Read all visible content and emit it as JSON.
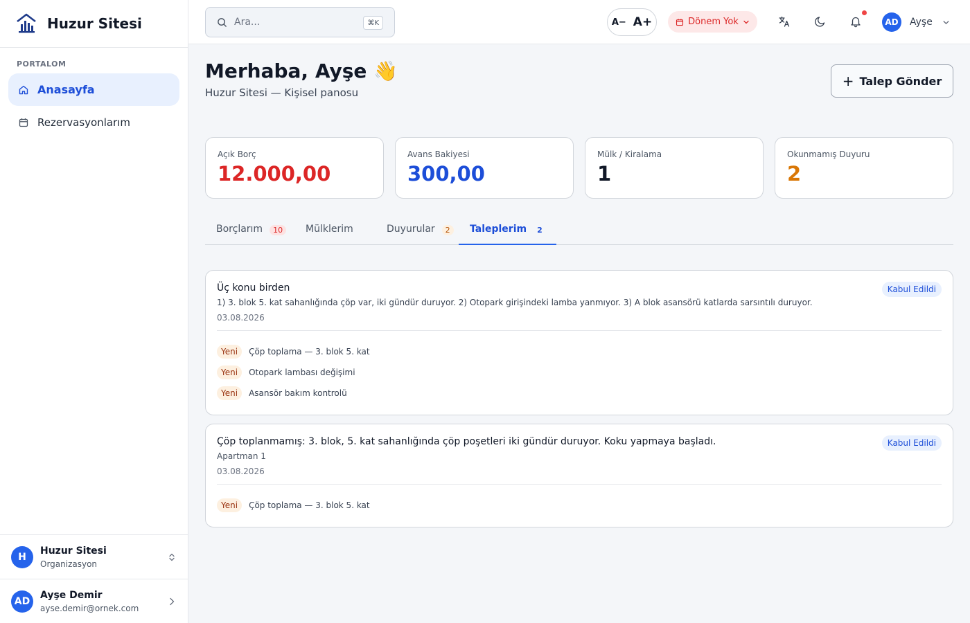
{
  "brand": {
    "name": "Huzur Sitesi"
  },
  "sidebar": {
    "section_label": "PORTALOM",
    "items": [
      {
        "label": "Anasayfa",
        "icon": "home-icon",
        "active": true
      },
      {
        "label": "Rezervasyonlarım",
        "icon": "calendar-icon",
        "active": false
      }
    ],
    "org": {
      "initial": "H",
      "name": "Huzur Sitesi",
      "type": "Organizasyon"
    },
    "user": {
      "initials": "AD",
      "name": "Ayşe Demir",
      "email": "ayse.demir@ornek.com"
    }
  },
  "header": {
    "search_placeholder": "Ara...",
    "search_shortcut": "⌘K",
    "font_decrease": "A−",
    "font_increase": "A+",
    "period_label": "Dönem Yok",
    "user_initials": "AD",
    "user_name": "Ayşe"
  },
  "main": {
    "greeting": "Merhaba, Ayşe 👋",
    "subtitle": "Huzur Sitesi — Kişisel panosu",
    "request_button": "Talep Gönder",
    "stats": [
      {
        "label": "Açık Borç",
        "value": "12.000,00",
        "color": "#dc2626"
      },
      {
        "label": "Avans Bakiyesi",
        "value": "300,00",
        "color": "#1d4ed8"
      },
      {
        "label": "Mülk / Kiralama",
        "value": "1",
        "color": "#111827"
      },
      {
        "label": "Okunmamış Duyuru",
        "value": "2",
        "color": "#d97706"
      }
    ],
    "tabs": [
      {
        "label": "Borçlarım",
        "badge": "10",
        "badge_bg": "#fde2e2",
        "badge_color": "#dc2626"
      },
      {
        "label": "Mülklerim",
        "badge": ""
      },
      {
        "label": "Duyurular",
        "badge": "2",
        "badge_bg": "#fdf0e0",
        "badge_color": "#b45309"
      },
      {
        "label": "Taleplerim",
        "badge": "2",
        "badge_bg": "transparent",
        "badge_color": "#1d4ed8",
        "active": true
      }
    ],
    "requests": [
      {
        "title": "Üç konu birden",
        "description": "1) 3. blok 5. kat sahanlığında çöp var, iki gündür duruyor. 2) Otopark girişindeki lamba yanmıyor. 3) A blok asansörü katlarda sarsıntılı duruyor.",
        "date": "03.08.2026",
        "status": "Kabul Edildi",
        "items": [
          {
            "status": "Yeni",
            "text": "Çöp toplama — 3. blok 5. kat"
          },
          {
            "status": "Yeni",
            "text": "Otopark lambası değişimi"
          },
          {
            "status": "Yeni",
            "text": "Asansör bakım kontrolü"
          }
        ]
      },
      {
        "title": "Çöp toplanmamış: 3. blok, 5. kat sahanlığında çöp poşetleri iki gündür duruyor. Koku yapmaya başladı.",
        "description": "Apartman 1",
        "date": "03.08.2026",
        "status": "Kabul Edildi",
        "items": [
          {
            "status": "Yeni",
            "text": "Çöp toplama — 3. blok 5. kat"
          }
        ]
      }
    ]
  }
}
